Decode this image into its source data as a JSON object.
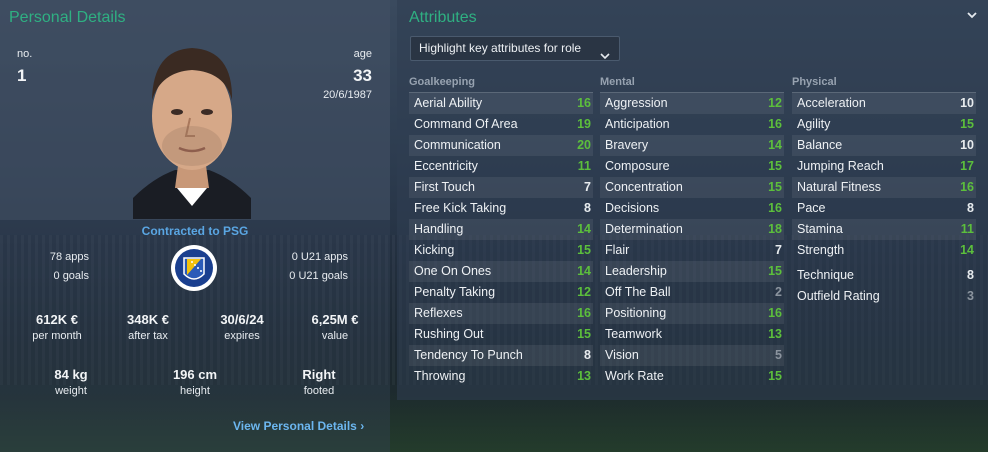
{
  "personal": {
    "title": "Personal Details",
    "no_label": "no.",
    "no_value": "1",
    "age_label": "age",
    "age_value": "33",
    "dob": "20/6/1987",
    "contract": "Contracted to PSG",
    "apps": "78 apps",
    "goals": "0 goals",
    "u21_apps": "0 U21 apps",
    "u21_goals": "0 U21 goals",
    "money": [
      {
        "value": "612K €",
        "label": "per month"
      },
      {
        "value": "348K €",
        "label": "after tax"
      },
      {
        "value": "30/6/24",
        "label": "expires"
      },
      {
        "value": "6,25M €",
        "label": "value"
      }
    ],
    "physical": [
      {
        "value": "84 kg",
        "label": "weight"
      },
      {
        "value": "196 cm",
        "label": "height"
      },
      {
        "value": "Right",
        "label": "footed"
      }
    ],
    "view_link": "View Personal Details"
  },
  "attributes": {
    "title": "Attributes",
    "dropdown_label": "Highlight key attributes for role",
    "colors": {
      "high": "#5cbf3c",
      "mid": "#e8ecef",
      "low": "#8b949e"
    },
    "columns": [
      {
        "heading": "Goalkeeping",
        "rows": [
          {
            "name": "Aerial Ability",
            "value": "16"
          },
          {
            "name": "Command Of Area",
            "value": "19"
          },
          {
            "name": "Communication",
            "value": "20"
          },
          {
            "name": "Eccentricity",
            "value": "11"
          },
          {
            "name": "First Touch",
            "value": "7"
          },
          {
            "name": "Free Kick Taking",
            "value": "8"
          },
          {
            "name": "Handling",
            "value": "14"
          },
          {
            "name": "Kicking",
            "value": "15"
          },
          {
            "name": "One On Ones",
            "value": "14"
          },
          {
            "name": "Penalty Taking",
            "value": "12"
          },
          {
            "name": "Reflexes",
            "value": "16"
          },
          {
            "name": "Rushing Out",
            "value": "15"
          },
          {
            "name": "Tendency To Punch",
            "value": "8"
          },
          {
            "name": "Throwing",
            "value": "13"
          }
        ]
      },
      {
        "heading": "Mental",
        "rows": [
          {
            "name": "Aggression",
            "value": "12"
          },
          {
            "name": "Anticipation",
            "value": "16"
          },
          {
            "name": "Bravery",
            "value": "14"
          },
          {
            "name": "Composure",
            "value": "15"
          },
          {
            "name": "Concentration",
            "value": "15"
          },
          {
            "name": "Decisions",
            "value": "16"
          },
          {
            "name": "Determination",
            "value": "18"
          },
          {
            "name": "Flair",
            "value": "7"
          },
          {
            "name": "Leadership",
            "value": "15"
          },
          {
            "name": "Off The Ball",
            "value": "2"
          },
          {
            "name": "Positioning",
            "value": "16"
          },
          {
            "name": "Teamwork",
            "value": "13"
          },
          {
            "name": "Vision",
            "value": "5"
          },
          {
            "name": "Work Rate",
            "value": "15"
          }
        ]
      },
      {
        "heading": "Physical",
        "rows": [
          {
            "name": "Acceleration",
            "value": "10"
          },
          {
            "name": "Agility",
            "value": "15"
          },
          {
            "name": "Balance",
            "value": "10"
          },
          {
            "name": "Jumping Reach",
            "value": "17"
          },
          {
            "name": "Natural Fitness",
            "value": "16"
          },
          {
            "name": "Pace",
            "value": "8"
          },
          {
            "name": "Stamina",
            "value": "11"
          },
          {
            "name": "Strength",
            "value": "14"
          }
        ],
        "extra_rows": [
          {
            "name": "Technique",
            "value": "8"
          },
          {
            "name": "Outfield Rating",
            "value": "3"
          }
        ]
      }
    ]
  }
}
